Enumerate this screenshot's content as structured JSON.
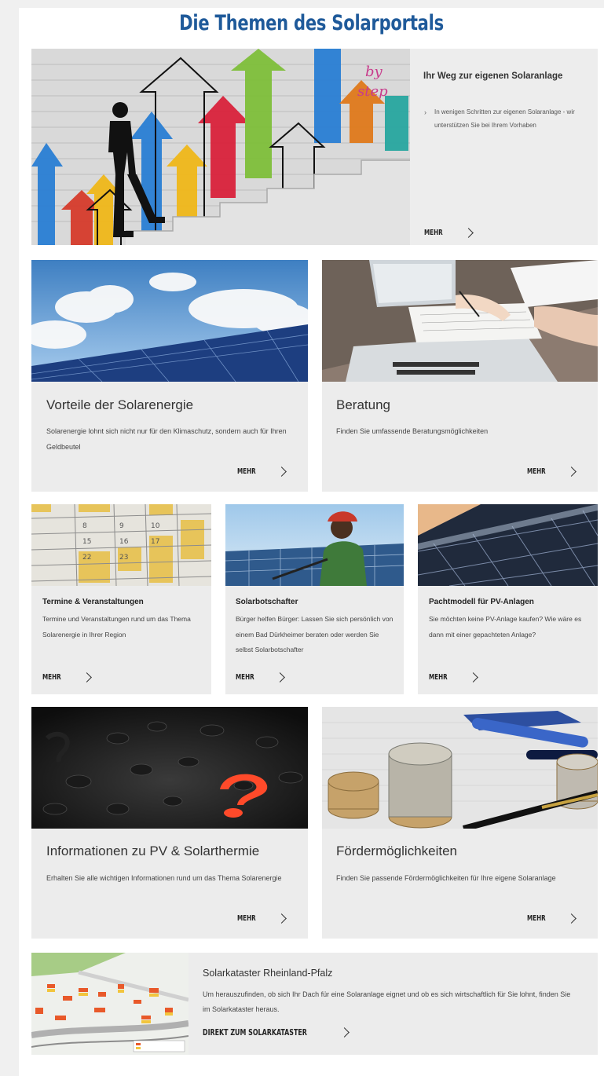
{
  "page": {
    "title": "Die Themen des Solarportals"
  },
  "more_label": "MEHR",
  "hero": {
    "title": "Ihr Weg zur eigenen Solaranlage",
    "bullet": "In wenigen Schritten zur eigenen Solaranlage - wir unterstützen Sie bei Ihrem Vorhaben",
    "image_text": "by\nstep"
  },
  "vorteile": {
    "title": "Vorteile der Solarenergie",
    "text": "Solarenergie lohnt sich nicht nur für den Klimaschutz, sondern auch für Ihren Geldbeutel"
  },
  "beratung": {
    "title": "Beratung",
    "text": "Finden Sie umfassende Beratungsmöglichkeiten"
  },
  "termine": {
    "title": "Termine & Veranstaltungen",
    "text": "Termine und Veranstaltungen rund um das Thema Solarenergie in Ihrer Region"
  },
  "botschafter": {
    "title": "Solarbotschafter",
    "text": "Bürger helfen Bürger: Lassen Sie sich persönlich von einem Bad Dürkheimer beraten oder werden Sie selbst Solarbotschafter"
  },
  "pacht": {
    "title": "Pachtmodell für PV-Anlagen",
    "text": "Sie möchten keine PV-Anlage kaufen? Wie wäre es dann mit einer gepachteten Anlage?"
  },
  "info": {
    "title": "Informationen zu PV & Solarthermie",
    "text": "Erhalten Sie alle wichtigen Informationen rund um das Thema Solarenergie"
  },
  "foerder": {
    "title": "Fördermöglichkeiten",
    "text": "Finden Sie passende Fördermöglichkeiten für Ihre eigene Solaranlage"
  },
  "kataster": {
    "title": "Solarkataster Rheinland-Pfalz",
    "text": "Um herauszufinden, ob sich Ihr Dach für eine Solaranlage eignet und ob es sich wirtschaftlich für Sie lohnt, finden Sie im Solarkataster heraus.",
    "link": "DIREKT ZUM SOLARKATASTER"
  },
  "colors": {
    "title_blue": "#1f5a9a",
    "card_bg": "#ececec"
  }
}
